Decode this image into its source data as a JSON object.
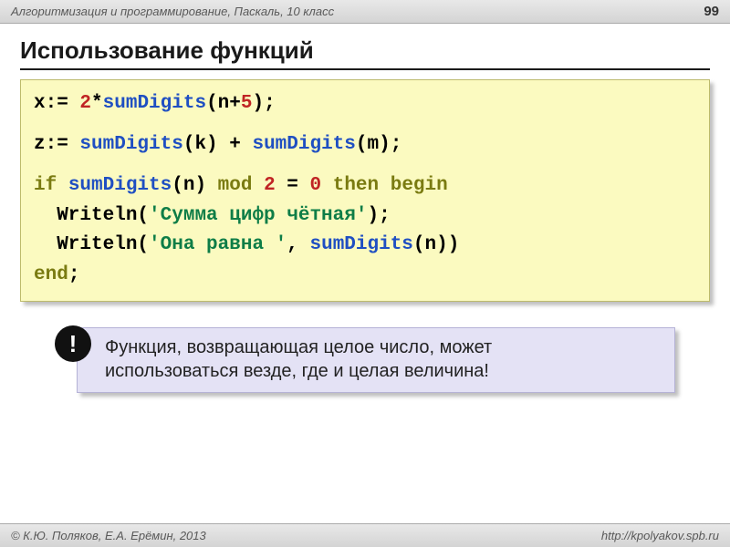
{
  "header": {
    "course": "Алгоритмизация и программирование, Паскаль, 10 класс",
    "page": "99"
  },
  "title": "Использование функций",
  "code": {
    "lines": [
      {
        "segments": [
          {
            "t": "x:= "
          },
          {
            "t": "2",
            "c": "k-red"
          },
          {
            "t": "*"
          },
          {
            "t": "sumDigits",
            "c": "k-blue"
          },
          {
            "t": "(n+"
          },
          {
            "t": "5",
            "c": "k-red"
          },
          {
            "t": ");"
          }
        ]
      },
      {
        "segments": []
      },
      {
        "segments": [
          {
            "t": "z:= "
          },
          {
            "t": "sumDigits",
            "c": "k-blue"
          },
          {
            "t": "(k) + "
          },
          {
            "t": "sumDigits",
            "c": "k-blue"
          },
          {
            "t": "(m);"
          }
        ]
      },
      {
        "segments": []
      },
      {
        "segments": [
          {
            "t": "if ",
            "c": "k-olive"
          },
          {
            "t": "sumDigits",
            "c": "k-blue"
          },
          {
            "t": "(n) "
          },
          {
            "t": "mod",
            "c": "k-olive"
          },
          {
            "t": " "
          },
          {
            "t": "2",
            "c": "k-red"
          },
          {
            "t": " = "
          },
          {
            "t": "0",
            "c": "k-red"
          },
          {
            "t": " "
          },
          {
            "t": "then begin",
            "c": "k-olive"
          }
        ]
      },
      {
        "segments": [
          {
            "t": "  Writeln("
          },
          {
            "t": "'Сумма цифр чётная'",
            "c": "k-teal"
          },
          {
            "t": ");"
          }
        ]
      },
      {
        "segments": [
          {
            "t": "  Writeln("
          },
          {
            "t": "'Она равна '",
            "c": "k-teal"
          },
          {
            "t": ", "
          },
          {
            "t": "sumDigits",
            "c": "k-blue"
          },
          {
            "t": "(n))"
          }
        ]
      },
      {
        "segments": [
          {
            "t": "end",
            "c": "k-olive"
          },
          {
            "t": ";"
          }
        ]
      }
    ]
  },
  "note": {
    "bang": "!",
    "line1": "Функция, возвращающая целое число, может",
    "line2": "использоваться везде, где и целая величина!"
  },
  "footer": {
    "authors": "© К.Ю. Поляков, Е.А. Ерёмин, 2013",
    "url": "http://kpolyakov.spb.ru"
  }
}
